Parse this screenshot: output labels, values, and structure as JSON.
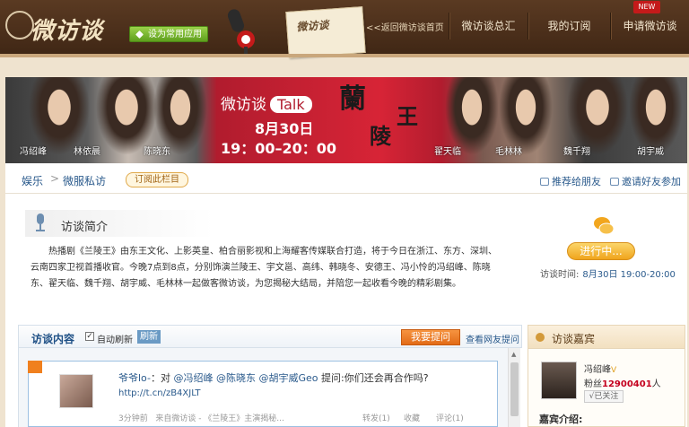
{
  "header": {
    "logo_text": "微访谈",
    "set_common_app": "设为常用应用",
    "back_link": "<<返回微访谈首页",
    "nav": [
      "微访谈总汇",
      "我的订阅",
      "申请微访谈"
    ],
    "new_badge": "NEW"
  },
  "banner": {
    "title": "微访谈",
    "talk": "Talk",
    "date": "8月30日",
    "time": "19：00–20：00",
    "king_1": "蘭",
    "king_2": "陵",
    "king_3": "王",
    "people": [
      "冯绍峰",
      "林依晨",
      "陈晓东",
      "翟天临",
      "毛林林",
      "魏千翔",
      "胡宇威"
    ]
  },
  "breadcrumb": {
    "category": "娱乐",
    "separator": ">",
    "column": "微服私访",
    "subscribe": "订阅此栏目"
  },
  "share": {
    "recommend": "推荐给朋友",
    "invite": "邀请好友参加"
  },
  "intro": {
    "heading": "访谈简介",
    "text": "热播剧《兰陵王》由东王文化、上影英皇、柏合丽影视和上海耀客传媒联合打造，将于今日在浙江、东方、深圳、云南四家卫视首播收官。今晚7点到8点，分别饰演兰陵王、宇文邕、高纬、韩晓冬、安德王、冯小怜的冯绍峰、陈晓东、翟天临、魏千翔、胡宇威、毛林林一起做客微访谈，为您揭秘大结局，并陪您一起收看今晚的精彩剧集。"
  },
  "status": {
    "label": "进行中...",
    "time_label": "访谈时间:",
    "time_value": "8月30日 19:00-20:00"
  },
  "feed": {
    "title": "访谈内容",
    "auto_refresh": "自动刷新",
    "refresh": "刷新",
    "ask": "我要提问",
    "view_questions": "查看网友提问",
    "post": {
      "user": "爷爷lo-",
      "colon": "：对",
      "mentions": "@冯绍峰 @陈晓东 @胡宇威Geo",
      "question": "提问:你们还会再合作吗?",
      "link": "http://t.cn/zB4XJLT",
      "time": "3分钟前",
      "source": "来自微访谈 - 《兰陵王》主演揭秘...",
      "forward": "转发(1)",
      "favorite": "收藏",
      "comment": "评论(1)"
    }
  },
  "guest": {
    "heading": "访谈嘉宾",
    "name": "冯绍峰",
    "verified": "V",
    "fans_label": "粉丝",
    "fans_value": "12900401",
    "fans_unit": "人",
    "followed": "√已关注",
    "intro_label": "嘉宾介绍:"
  },
  "colors": {
    "header_brown": "#4a2e1a",
    "banner_red": "#d72436",
    "link_blue": "#2a5a8c",
    "orange": "#f0801e",
    "green": "#5e9f1d"
  }
}
